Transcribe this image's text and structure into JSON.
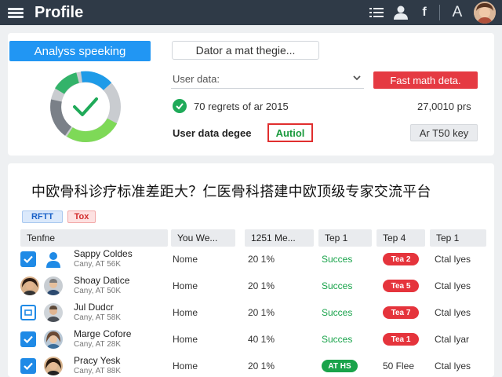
{
  "topbar": {
    "title": "Profile",
    "icons": [
      "menu-icon",
      "list-icon",
      "user-icon",
      "facebook-icon",
      "font-icon",
      "avatar"
    ],
    "font_glyph": "A",
    "fb_glyph": "f"
  },
  "analysis": {
    "primary_button": "Analyss speeking",
    "secondary_button": "Dator a mat thegie...",
    "donut_segments_colors": [
      "#1e9be8",
      "#7ed957",
      "#33b36a",
      "#c9ccd0"
    ]
  },
  "user_data": {
    "label": "User data:",
    "action_button": "Fast math deta.",
    "records_text": "70 regrets of ar 2015",
    "records_value": "27,0010 prs",
    "degree_label": "User data degee",
    "degree_badge": "Autiol",
    "key_button": "Ar T50 key"
  },
  "banner": "中欧骨科诊疗标准差距大？仁医骨科搭建中欧顶级专家交流平台",
  "table": {
    "chips": [
      "RFTT",
      "Tox"
    ],
    "headers": [
      "Tenfne",
      "You We...",
      "1251 Me...",
      "Tep 1",
      "Tep 4",
      "Tep 1"
    ],
    "rows": [
      {
        "name": "Sappy Coldes",
        "sub": "Cany, AT 56K",
        "col2": "Nome",
        "col3": "20 1%",
        "status": "Succes",
        "pill": "Tea 2",
        "last": "Ctal lyes"
      },
      {
        "name": "Shoay Datice",
        "sub": "Cany, AT 50K",
        "col2": "Home",
        "col3": "20 1%",
        "status": "Succes",
        "pill": "Tea 5",
        "last": "Ctal lyes"
      },
      {
        "name": "Jul Dudcr",
        "sub": "Cany, AT 58K",
        "col2": "Home",
        "col3": "20 1%",
        "status": "Succes",
        "pill": "Tea 7",
        "last": "Ctal lyes"
      },
      {
        "name": "Marge Cofore",
        "sub": "Cany, AT 28K",
        "col2": "Home",
        "col3": "40 1%",
        "status": "Succes",
        "pill": "Tea 1",
        "last": "Ctal lyar"
      },
      {
        "name": "Pracy Yesk",
        "sub": "Cany, AT 88K",
        "col2": "Home",
        "col3": "20 1%",
        "status_pill": "AT HS",
        "pill_text": "50 Flee",
        "last": "Ctal lyes"
      }
    ]
  },
  "colors": {
    "topbar_bg": "#2f3a47",
    "primary_blue": "#2196f3",
    "danger_red": "#e53a42",
    "success_green": "#1aa34a"
  }
}
